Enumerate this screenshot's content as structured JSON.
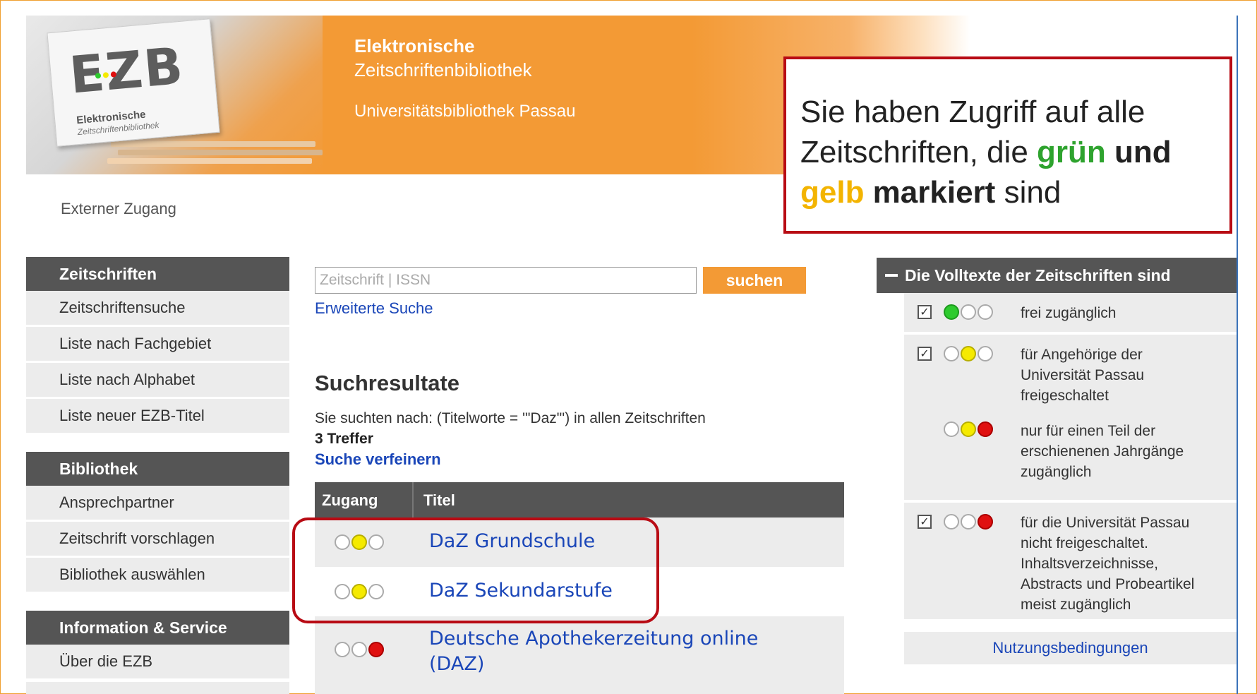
{
  "header": {
    "title": "Elektronische",
    "subtitle": "Zeitschriftenbibliothek",
    "institution": "Universitätsbibliothek Passau",
    "logo_text": "EZB",
    "logo_caption1": "Elektronische",
    "logo_caption2": "Zeitschriftenbibliothek",
    "external_access": "Externer Zugang"
  },
  "callout": {
    "part1": "Sie haben Zugriff auf alle Zeitschriften, die ",
    "green_word": "grün",
    "and_word": " und ",
    "yellow_word": "gelb",
    "marked_word": " markiert",
    "end": " sind"
  },
  "sidebar": {
    "sections": [
      {
        "heading": "Zeitschriften",
        "items": [
          "Zeitschriftensuche",
          "Liste nach Fachgebiet",
          "Liste nach Alphabet",
          "Liste neuer EZB-Titel"
        ]
      },
      {
        "heading": "Bibliothek",
        "items": [
          "Ansprechpartner",
          "Zeitschrift vorschlagen",
          "Bibliothek auswählen"
        ]
      },
      {
        "heading": "Information & Service",
        "items": [
          "Über die EZB"
        ]
      }
    ]
  },
  "search": {
    "placeholder": "Zeitschrift | ISSN",
    "button_label": "suchen",
    "advanced_link": "Erweiterte Suche"
  },
  "results": {
    "heading": "Suchresultate",
    "query_text": "Sie suchten nach: (Titelworte = '\"Daz\"') in allen Zeitschriften",
    "count_text": "3 Treffer",
    "refine_link": "Suche verfeinern",
    "columns": [
      "Zugang",
      "Titel"
    ],
    "rows": [
      {
        "title": "DaZ Grundschule",
        "access": "yellow"
      },
      {
        "title": "DaZ Sekundarstufe",
        "access": "yellow"
      },
      {
        "title_line1": "Deutsche Apothekerzeitung online",
        "title_line2": "(DAZ)",
        "access": "red"
      }
    ]
  },
  "legend": {
    "heading": "Die Volltexte der Zeitschriften sind",
    "items": [
      {
        "checked": true,
        "lights": "green",
        "text": "frei zugänglich"
      },
      {
        "checked": true,
        "lights": "yellow",
        "text_lines": [
          "für Angehörige der",
          "Universität Passau",
          "freigeschaltet"
        ]
      },
      {
        "checked": false,
        "lights": "yellow-red",
        "text_lines": [
          "nur für einen Teil der",
          "erschienenen Jahrgänge",
          "zugänglich"
        ]
      },
      {
        "checked": true,
        "lights": "red",
        "text_lines": [
          "für die Universität Passau",
          "nicht freigeschaltet.",
          "Inhaltsverzeichnisse,",
          "Abstracts und Probeartikel",
          "meist zugänglich"
        ]
      }
    ],
    "footer_link": "Nutzungsbedingungen"
  },
  "colors": {
    "brand_orange": "#f39a35",
    "callout_border": "#b80b14",
    "link_blue": "#1a46b8",
    "green_highlight": "#2ea32e",
    "yellow_highlight": "#f3b400",
    "header_gray": "#555555"
  }
}
